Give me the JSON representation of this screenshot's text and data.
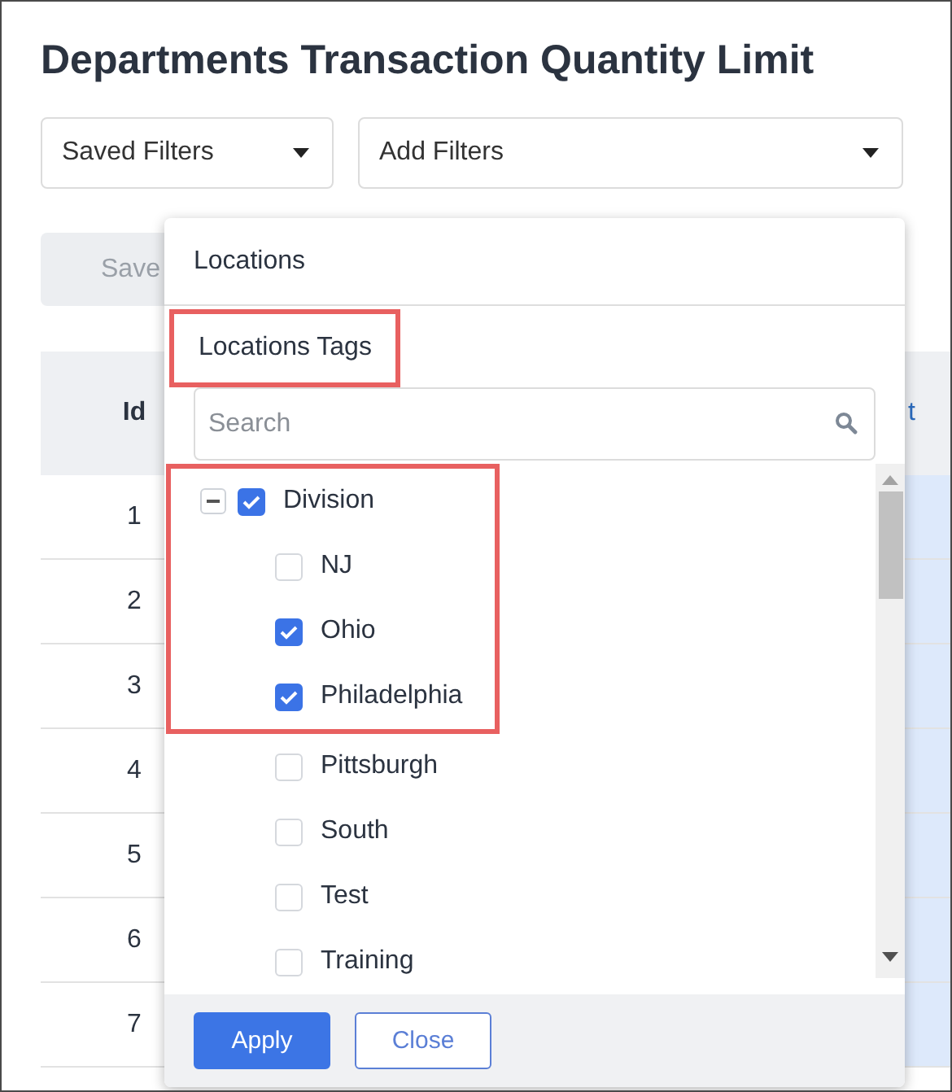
{
  "title": "Departments Transaction Quantity Limit",
  "filters": {
    "saved_filters": "Saved Filters",
    "add_filters": "Add Filters"
  },
  "save_button": "Save",
  "table": {
    "columns": [
      "Id",
      "t"
    ],
    "rows": [
      {
        "id": "1"
      },
      {
        "id": "2"
      },
      {
        "id": "3"
      },
      {
        "id": "4"
      },
      {
        "id": "5"
      },
      {
        "id": "6"
      },
      {
        "id": "7"
      }
    ]
  },
  "popup": {
    "categories": [
      {
        "label": "Locations",
        "highlighted": false
      },
      {
        "label": "Locations Tags",
        "highlighted": true
      }
    ],
    "search": {
      "placeholder": "Search"
    },
    "tree": [
      {
        "label": "Division",
        "expanded": true,
        "checked": true,
        "highlighted": true,
        "children": [
          {
            "label": "NJ",
            "checked": false,
            "highlighted": true
          },
          {
            "label": "Ohio",
            "checked": true,
            "highlighted": true
          },
          {
            "label": "Philadelphia",
            "checked": true,
            "highlighted": true
          },
          {
            "label": "Pittsburgh",
            "checked": false,
            "highlighted": false
          },
          {
            "label": "South",
            "checked": false,
            "highlighted": false
          },
          {
            "label": "Test",
            "checked": false,
            "highlighted": false
          },
          {
            "label": "Training",
            "checked": false,
            "highlighted": false
          }
        ]
      }
    ],
    "buttons": [
      {
        "label": "Apply",
        "kind": "primary"
      },
      {
        "label": "Close",
        "kind": "secondary"
      }
    ]
  }
}
